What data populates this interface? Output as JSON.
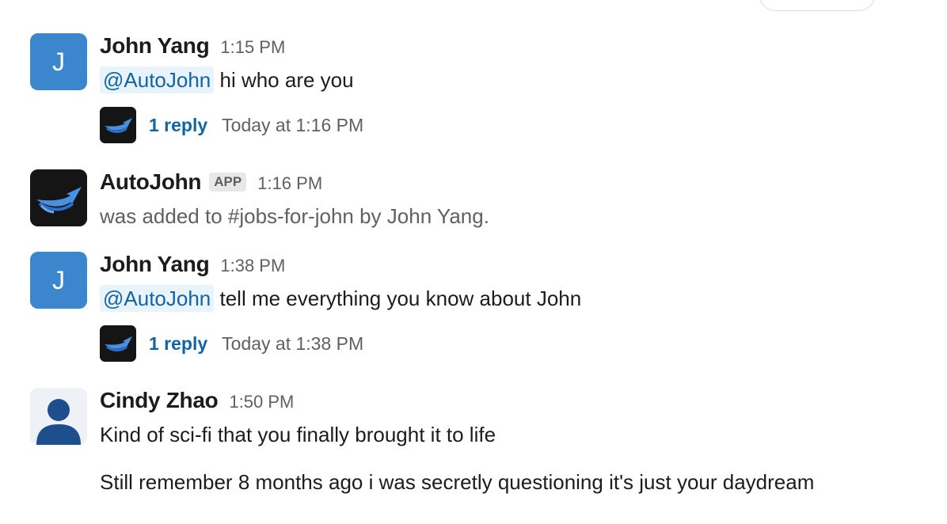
{
  "messages": [
    {
      "author": "John Yang",
      "avatar_letter": "J",
      "time": "1:15 PM",
      "mention": "@AutoJohn",
      "text": " hi who are you",
      "thread": {
        "replies": "1 reply",
        "last_reply": "Today at 1:16 PM"
      }
    },
    {
      "author": "AutoJohn",
      "badge": "APP",
      "time": "1:16 PM",
      "text": "was added to #jobs-for-john by John Yang."
    },
    {
      "author": "John Yang",
      "avatar_letter": "J",
      "time": "1:38 PM",
      "mention": "@AutoJohn",
      "text": " tell me everything you know about John",
      "thread": {
        "replies": "1 reply",
        "last_reply": "Today at 1:38 PM"
      }
    },
    {
      "author": "Cindy Zhao",
      "time": "1:50 PM",
      "lines": [
        "Kind of sci-fi that you finally brought it to life",
        "Still remember 8 months ago i was secretly questioning it's just your daydream"
      ]
    }
  ],
  "colors": {
    "avatar_blue": "#3b86cd",
    "link": "#1264a3",
    "mention_bg": "#e8f3fb",
    "muted": "#616061"
  },
  "icons": {
    "bot_avatar": "swoosh-logo-icon",
    "user_avatar": "person-silhouette-icon"
  }
}
